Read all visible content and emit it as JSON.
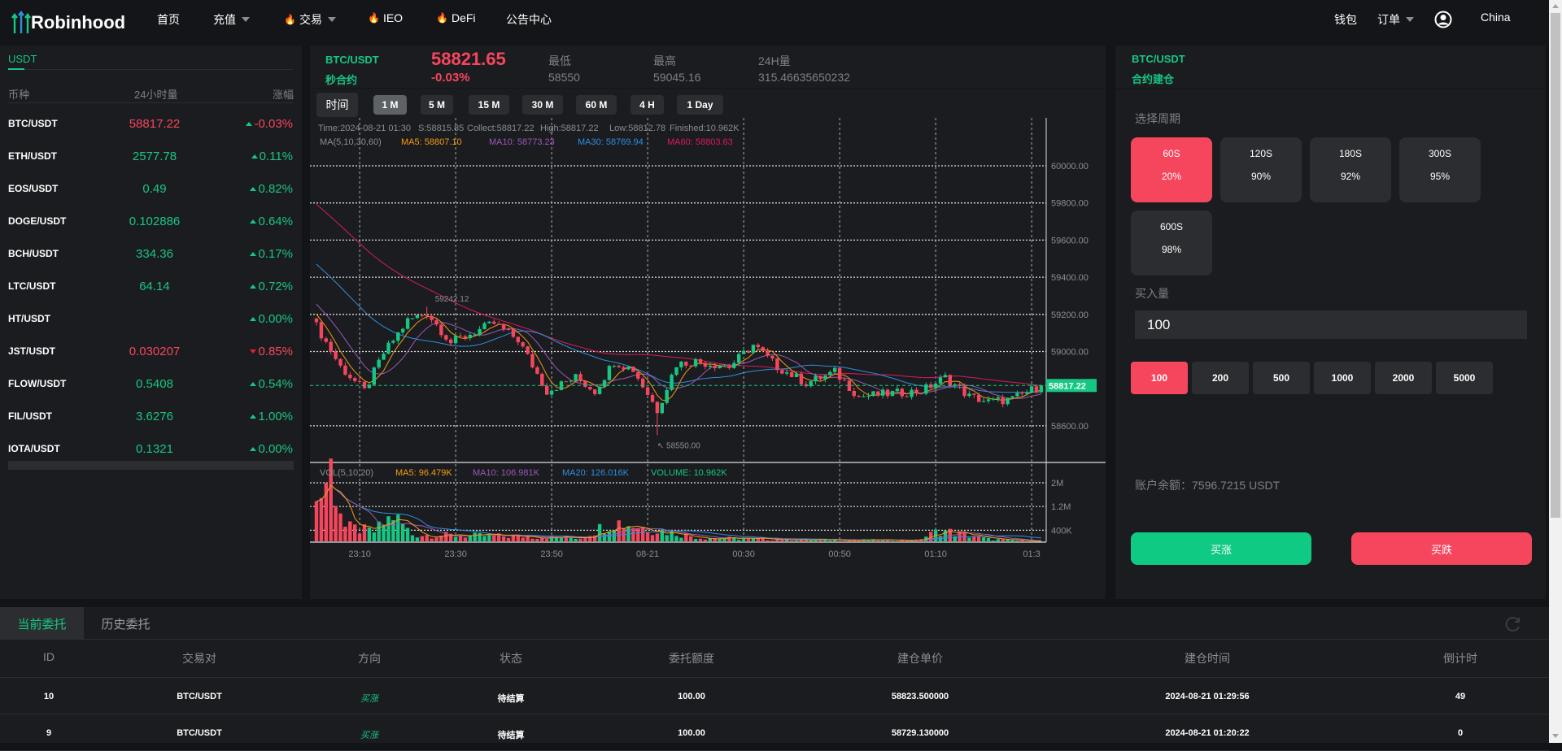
{
  "nav": {
    "logo": "Robinhood",
    "items": [
      {
        "label": "首页",
        "fire": false,
        "caret": false
      },
      {
        "label": "充值",
        "fire": false,
        "caret": true
      },
      {
        "label": "交易",
        "fire": true,
        "caret": true
      },
      {
        "label": "IEO",
        "fire": true,
        "caret": false
      },
      {
        "label": "DeFi",
        "fire": true,
        "caret": false
      },
      {
        "label": "公告中心",
        "fire": false,
        "caret": false
      }
    ],
    "wallet": "钱包",
    "orders": "订单",
    "region": "China"
  },
  "market": {
    "tab": "USDT",
    "headers": [
      "币种",
      "24小时量",
      "涨幅"
    ],
    "rows": [
      {
        "pair": "BTC/USDT",
        "price": "58817.22",
        "change": "-0.03%",
        "price_dir": "down",
        "change_dir": "up"
      },
      {
        "pair": "ETH/USDT",
        "price": "2577.78",
        "change": "0.11%",
        "price_dir": "up",
        "change_dir": "up"
      },
      {
        "pair": "EOS/USDT",
        "price": "0.49",
        "change": "0.82%",
        "price_dir": "up",
        "change_dir": "up"
      },
      {
        "pair": "DOGE/USDT",
        "price": "0.102886",
        "change": "0.64%",
        "price_dir": "up",
        "change_dir": "up"
      },
      {
        "pair": "BCH/USDT",
        "price": "334.36",
        "change": "0.17%",
        "price_dir": "up",
        "change_dir": "up"
      },
      {
        "pair": "LTC/USDT",
        "price": "64.14",
        "change": "0.72%",
        "price_dir": "up",
        "change_dir": "up"
      },
      {
        "pair": "HT/USDT",
        "price": "",
        "change": "0.00%",
        "price_dir": "up",
        "change_dir": "up"
      },
      {
        "pair": "JST/USDT",
        "price": "0.030207",
        "change": "0.85%",
        "price_dir": "down",
        "change_dir": "down"
      },
      {
        "pair": "FLOW/USDT",
        "price": "0.5408",
        "change": "0.54%",
        "price_dir": "up",
        "change_dir": "up"
      },
      {
        "pair": "FIL/USDT",
        "price": "3.6276",
        "change": "1.00%",
        "price_dir": "up",
        "change_dir": "up"
      },
      {
        "pair": "IOTA/USDT",
        "price": "0.1321",
        "change": "0.00%",
        "price_dir": "up",
        "change_dir": "up"
      }
    ]
  },
  "ticker": {
    "pair": "BTC/USDT",
    "sub": "秒合约",
    "price": "58821.65",
    "change": "-0.03%",
    "low_label": "最低",
    "low": "58550",
    "high_label": "最高",
    "high": "59045.16",
    "vol_label": "24H量",
    "vol": "315.46635650232"
  },
  "intervals": {
    "label": "时间",
    "items": [
      "1 M",
      "5 M",
      "15 M",
      "30 M",
      "60 M",
      "4 H",
      "1 Day"
    ],
    "active": 0
  },
  "chart_data": {
    "type": "candlestick",
    "title": "BTC/USDT 1M",
    "info": "Time:2024-08-21 01:30",
    "info_s": "S:58815.85",
    "info_collect": "Collect:58817.22",
    "info_high": "High:58817.22",
    "info_low": "Low:58812.78",
    "info_finished": "Finished:10.962K",
    "ma_label": "MA(5,10,30,60)",
    "ma5": "MA5: 58807.10",
    "ma10": "MA10: 58773.23",
    "ma30": "MA30: 58769.94",
    "ma60": "MA60: 58803.63",
    "vol_label": "VOL(5,10,20)",
    "vma5": "MA5: 96.479K",
    "vma10": "MA10: 106.981K",
    "vma20": "MA20: 126.016K",
    "volume": "VOLUME: 10.962K",
    "y_ticks": [
      "60000.00",
      "59800.00",
      "59600.00",
      "59400.00",
      "59200.00",
      "59000.00",
      "58600.00"
    ],
    "y_values": [
      60000,
      59800,
      59600,
      59400,
      59200,
      59000,
      58600
    ],
    "vol_ticks": [
      "2M",
      "1.2M",
      "400K"
    ],
    "vol_values": [
      2000000,
      1200000,
      400000
    ],
    "x_ticks": [
      "23:10",
      "23:30",
      "23:50",
      "08-21",
      "00:30",
      "00:50",
      "01:10",
      "01:3"
    ],
    "x_minutes": [
      9,
      29,
      49,
      69,
      89,
      109,
      129,
      149
    ],
    "ylim": [
      58450,
      60150
    ],
    "minutes": 152,
    "close_anchors": [
      [
        0,
        59137
      ],
      [
        5,
        58918
      ],
      [
        10,
        58787
      ],
      [
        14,
        58991
      ],
      [
        19,
        59166
      ],
      [
        23,
        59210
      ],
      [
        28,
        59049
      ],
      [
        37,
        59151
      ],
      [
        42,
        59064
      ],
      [
        48,
        58787
      ],
      [
        54,
        58860
      ],
      [
        58,
        58787
      ],
      [
        62,
        58947
      ],
      [
        66,
        58903
      ],
      [
        71,
        58685
      ],
      [
        75,
        58932
      ],
      [
        79,
        58947
      ],
      [
        86,
        58918
      ],
      [
        91,
        59035
      ],
      [
        96,
        58918
      ],
      [
        102,
        58830
      ],
      [
        108,
        58889
      ],
      [
        113,
        58758
      ],
      [
        119,
        58772
      ],
      [
        126,
        58787
      ],
      [
        131,
        58860
      ],
      [
        136,
        58758
      ],
      [
        140,
        58729
      ],
      [
        145,
        58743
      ],
      [
        151,
        58817.22
      ]
    ],
    "volume_anchors": [
      [
        0,
        1300000
      ],
      [
        3,
        2500000
      ],
      [
        6,
        500000
      ],
      [
        12,
        350000
      ],
      [
        16,
        900000
      ],
      [
        20,
        250000
      ],
      [
        40,
        200000
      ],
      [
        55,
        150000
      ],
      [
        62,
        700000
      ],
      [
        70,
        450000
      ],
      [
        80,
        150000
      ],
      [
        100,
        80000
      ],
      [
        125,
        60000
      ],
      [
        130,
        400000
      ],
      [
        140,
        100000
      ],
      [
        151,
        11000
      ]
    ],
    "max_label": "59242.12",
    "max_minute": 23,
    "max_value": 59242.12,
    "min_label": "58550.00",
    "min_minute": 71,
    "min_value": 58550,
    "last_label": "58817.22",
    "last_value": 58817.22,
    "colors": {
      "up": "#16c784",
      "down": "#f6465d",
      "ma5": "#f39c12",
      "ma10": "#9b59b6",
      "ma30": "#2e8fe0",
      "ma60": "#d81b60"
    }
  },
  "trade": {
    "pair": "BTC/USDT",
    "sub": "合约建仓",
    "period_label": "选择周期",
    "periods": [
      {
        "t": "60S",
        "p": "20%"
      },
      {
        "t": "120S",
        "p": "90%"
      },
      {
        "t": "180S",
        "p": "92%"
      },
      {
        "t": "300S",
        "p": "95%"
      },
      {
        "t": "600S",
        "p": "98%"
      }
    ],
    "active_period": 0,
    "amount_label": "买入量",
    "amount": "100",
    "amounts": [
      "100",
      "200",
      "500",
      "1000",
      "2000",
      "5000"
    ],
    "active_amount": 0,
    "balance": "账户余额：7596.7215 USDT",
    "buy_up": "买涨",
    "buy_down": "买跌"
  },
  "orders": {
    "tabs": [
      "当前委托",
      "历史委托"
    ],
    "headers": [
      "ID",
      "交易对",
      "方向",
      "状态",
      "委托额度",
      "建仓单价",
      "建仓时间",
      "倒计时"
    ],
    "rows": [
      [
        "10",
        "BTC/USDT",
        "买涨",
        "待结算",
        "100.00",
        "58823.500000",
        "2024-08-21 01:29:56",
        "49"
      ],
      [
        "9",
        "BTC/USDT",
        "买涨",
        "待结算",
        "100.00",
        "58729.130000",
        "2024-08-21 01:20:22",
        "0"
      ]
    ]
  }
}
